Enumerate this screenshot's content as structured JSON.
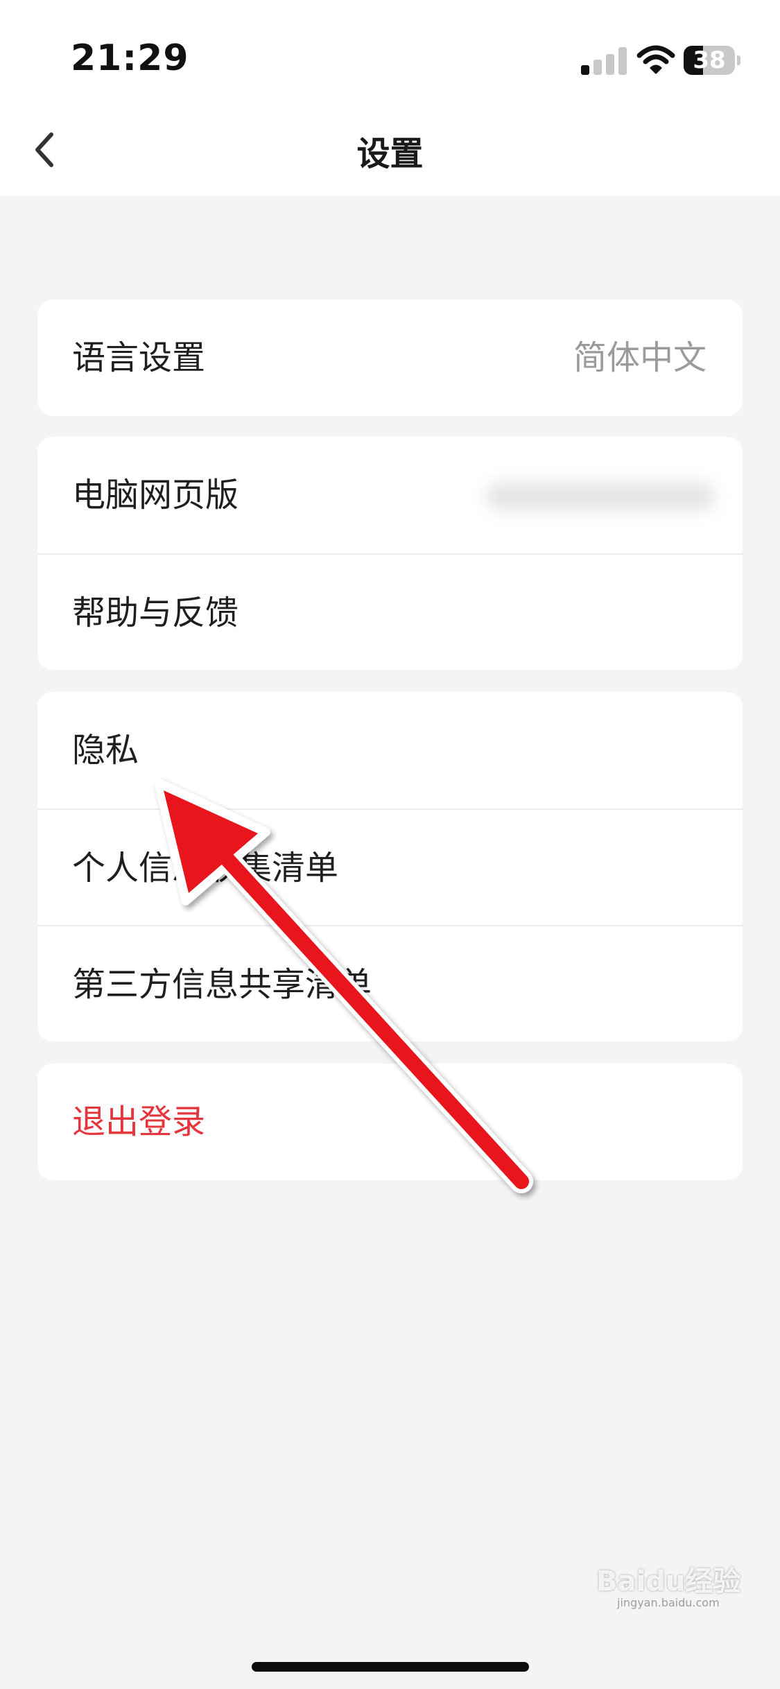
{
  "status_bar": {
    "time": "21:29",
    "battery": "38",
    "battery_level": 0.38,
    "signal_bars_active": 1,
    "signal_bars_total": 4
  },
  "nav": {
    "title": "设置",
    "back_icon": "chevron-left-icon"
  },
  "groups": [
    {
      "rows": [
        {
          "label": "语言设置",
          "value": "简体中文"
        }
      ]
    },
    {
      "rows": [
        {
          "label": "电脑网页版"
        },
        {
          "label": "帮助与反馈"
        }
      ]
    },
    {
      "rows": [
        {
          "label": "隐私"
        },
        {
          "label": "个人信息收集清单"
        },
        {
          "label": "第三方信息共享清单"
        }
      ]
    },
    {
      "rows": [
        {
          "label": "退出登录",
          "style": "danger"
        }
      ]
    }
  ],
  "annotation": {
    "icon": "red-arrow",
    "color": "#e8141e"
  },
  "watermark": {
    "text": "Baidu经验",
    "sub": "jingyan.baidu.com"
  },
  "colors": {
    "background": "#f3f4f6",
    "card": "#ffffff",
    "danger": "#e5353d",
    "secondary_text": "#9a9a9f"
  }
}
